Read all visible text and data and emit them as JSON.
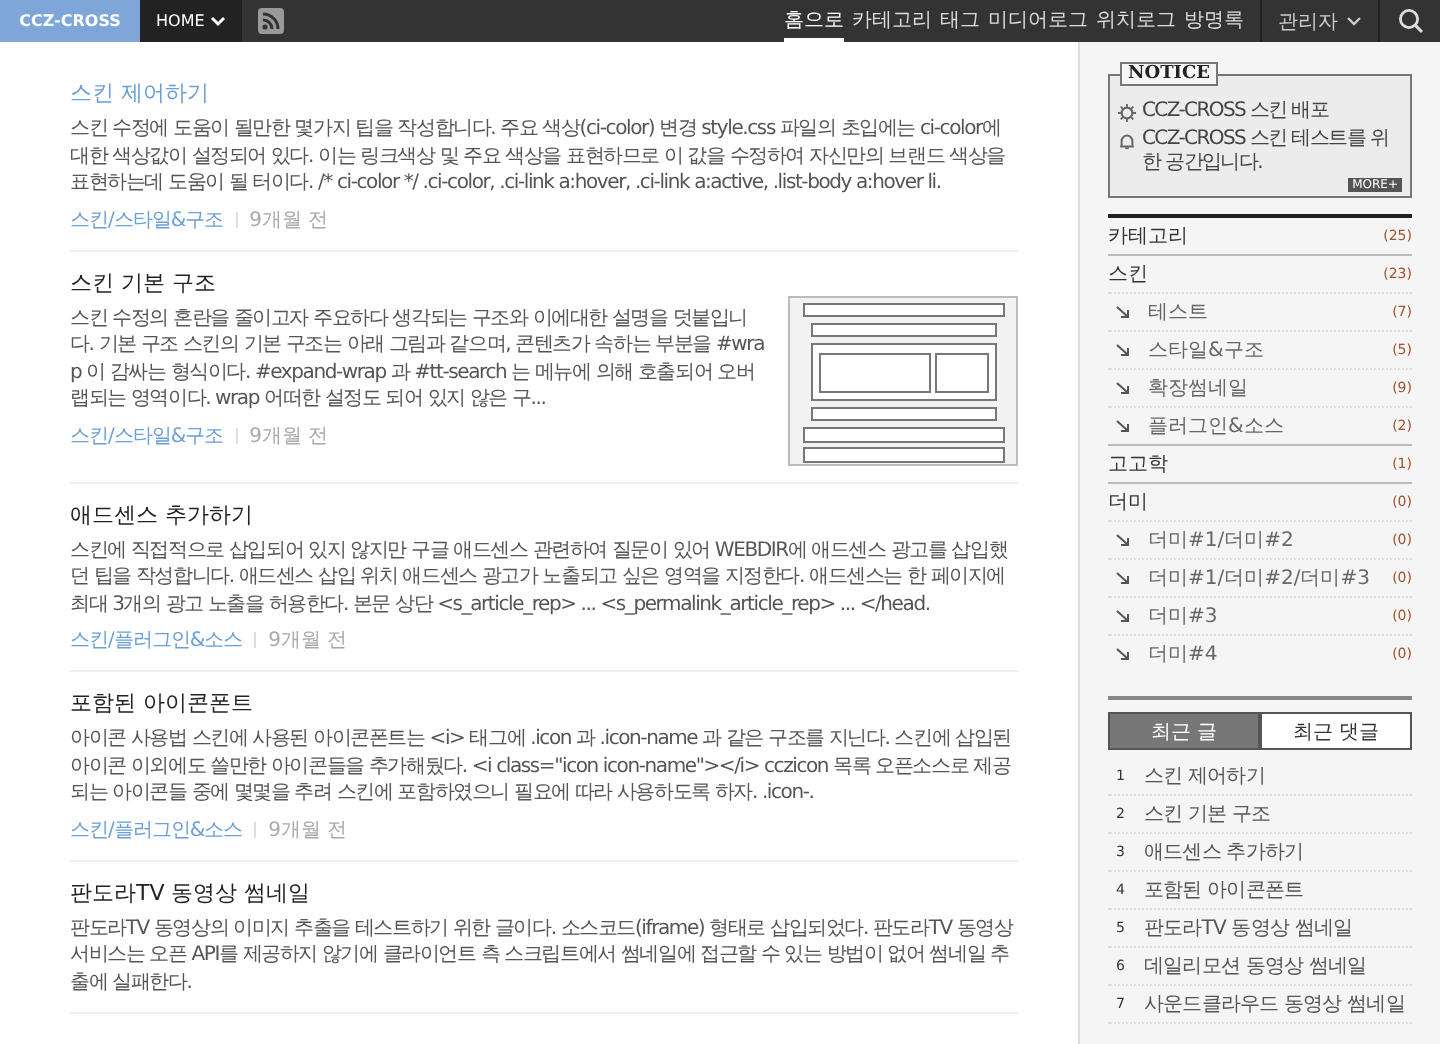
{
  "topbar": {
    "logo": "CCZ-CROSS",
    "home": "HOME",
    "nav": [
      {
        "label": "홈으로",
        "selected": true
      },
      {
        "label": "카테고리",
        "selected": false
      },
      {
        "label": "태그",
        "selected": false
      },
      {
        "label": "미디어로그",
        "selected": false
      },
      {
        "label": "위치로그",
        "selected": false
      },
      {
        "label": "방명록",
        "selected": false
      }
    ],
    "admin": "관리자"
  },
  "posts": [
    {
      "title": "스킨 제어하기",
      "highlighted": true,
      "has_thumbnail": false,
      "summary": "스킨 수정에 도움이 될만한 몇가지 팁을 작성합니다. 주요 색상(ci-color) 변경 style.css 파일의 초입에는 ci-color에 대한 색상값이 설정되어 있다. 이는 링크색상 및 주요 색상을 표현하므로 이 값을 수정하여 자신만의 브랜드 색상을 표현하는데 도움이 될 터이다. /* ci-color */ .ci-color, .ci-link a:hover, .ci-link a:active, .list-body a:hover li.",
      "category": "스킨/스타일&구조",
      "time": "9개월 전"
    },
    {
      "title": "스킨 기본 구조",
      "highlighted": false,
      "has_thumbnail": true,
      "summary": "스킨 수정의 혼란을 줄이고자 주요하다 생각되는 구조와 이에대한 설명을 덧붙입니다. 기본 구조 스킨의 기본 구조는 아래 그림과 같으며, 콘텐츠가 속하는 부분을 #wrap 이 감싸는 형식이다. #expand-wrap 과 #tt-search 는 메뉴에 의해 호출되어 오버랩되는 영역이다. wrap 어떠한 설정도 되어 있지 않은 구...",
      "category": "스킨/스타일&구조",
      "time": "9개월 전"
    },
    {
      "title": "애드센스 추가하기",
      "highlighted": false,
      "has_thumbnail": false,
      "summary": "스킨에 직접적으로 삽입되어 있지 않지만 구글 애드센스 관련하여 질문이 있어 WEBDIR에 애드센스 광고를 삽입했던 팁을 작성합니다. 애드센스 삽입 위치 애드센스 광고가 노출되고 싶은 영역을 지정한다. 애드센스는 한 페이지에 최대 3개의 광고 노출을 허용한다. 본문 상단 <s_article_rep> ... <s_permalink_article_rep> ... </head.",
      "category": "스킨/플러그인&소스",
      "time": "9개월 전"
    },
    {
      "title": "포함된 아이콘폰트",
      "highlighted": false,
      "has_thumbnail": false,
      "summary": "아이콘 사용법 스킨에 사용된 아이콘폰트는 <i> 태그에 .icon 과 .icon-name 과 같은 구조를 지닌다. 스킨에 삽입된 아이콘 이외에도 쓸만한 아이콘들을 추가해뒀다. <i class=\"icon icon-name\"></i> cczicon 목록 오픈소스로 제공되는 아이콘들 중에 몇몇을 추려 스킨에 포함하였으니 필요에 따라 사용하도록 하자. .icon-.",
      "category": "스킨/플러그인&소스",
      "time": "9개월 전"
    },
    {
      "title": "판도라TV 동영상 썸네일",
      "highlighted": false,
      "has_thumbnail": false,
      "summary": "판도라TV 동영상의 이미지 추출을 테스트하기 위한 글이다. 소스코드(iframe) 형태로 삽입되었다. 판도라TV 동영상 서비스는 오픈 API를 제공하지 않기에 클라이언트 측 스크립트에서 썸네일에 접근할 수 있는 방법이 없어 썸네일 추출에 실패한다."
    }
  ],
  "sidebar": {
    "notice": {
      "title": "NOTICE",
      "items": [
        {
          "kind": "gear",
          "text": "CCZ-CROSS 스킨 배포"
        },
        {
          "kind": "bell",
          "text": "CCZ-CROSS 스킨 테스트를 위한 공간입니다."
        }
      ],
      "more": "MORE+"
    },
    "categories": [
      {
        "label": "카테고리",
        "count": "(25)"
      },
      {
        "label": "스킨",
        "count": "(23)",
        "children": [
          {
            "label": "테스트",
            "count": "(7)"
          },
          {
            "label": "스타일&구조",
            "count": "(5)"
          },
          {
            "label": "확장썸네일",
            "count": "(9)"
          },
          {
            "label": "플러그인&소스",
            "count": "(2)"
          }
        ]
      },
      {
        "label": "고고학",
        "count": "(1)"
      },
      {
        "label": "더미",
        "count": "(0)",
        "children": [
          {
            "label": "더미#1/더미#2",
            "count": "(0)"
          },
          {
            "label": "더미#1/더미#2/더미#3",
            "count": "(0)"
          },
          {
            "label": "더미#3",
            "count": "(0)"
          },
          {
            "label": "더미#4",
            "count": "(0)"
          }
        ]
      }
    ],
    "tabs": [
      {
        "label": "최근 글",
        "selected": true
      },
      {
        "label": "최근 댓글",
        "selected": false
      }
    ],
    "recent": [
      {
        "num": "1",
        "title": "스킨 제어하기"
      },
      {
        "num": "2",
        "title": "스킨 기본 구조"
      },
      {
        "num": "3",
        "title": "애드센스 추가하기"
      },
      {
        "num": "4",
        "title": "포함된 아이콘폰트"
      },
      {
        "num": "5",
        "title": "판도라TV 동영상 썸네일"
      },
      {
        "num": "6",
        "title": "데일리모션 동영상 썸네일"
      },
      {
        "num": "7",
        "title": "사운드클라우드 동영상 썸네일"
      }
    ]
  }
}
